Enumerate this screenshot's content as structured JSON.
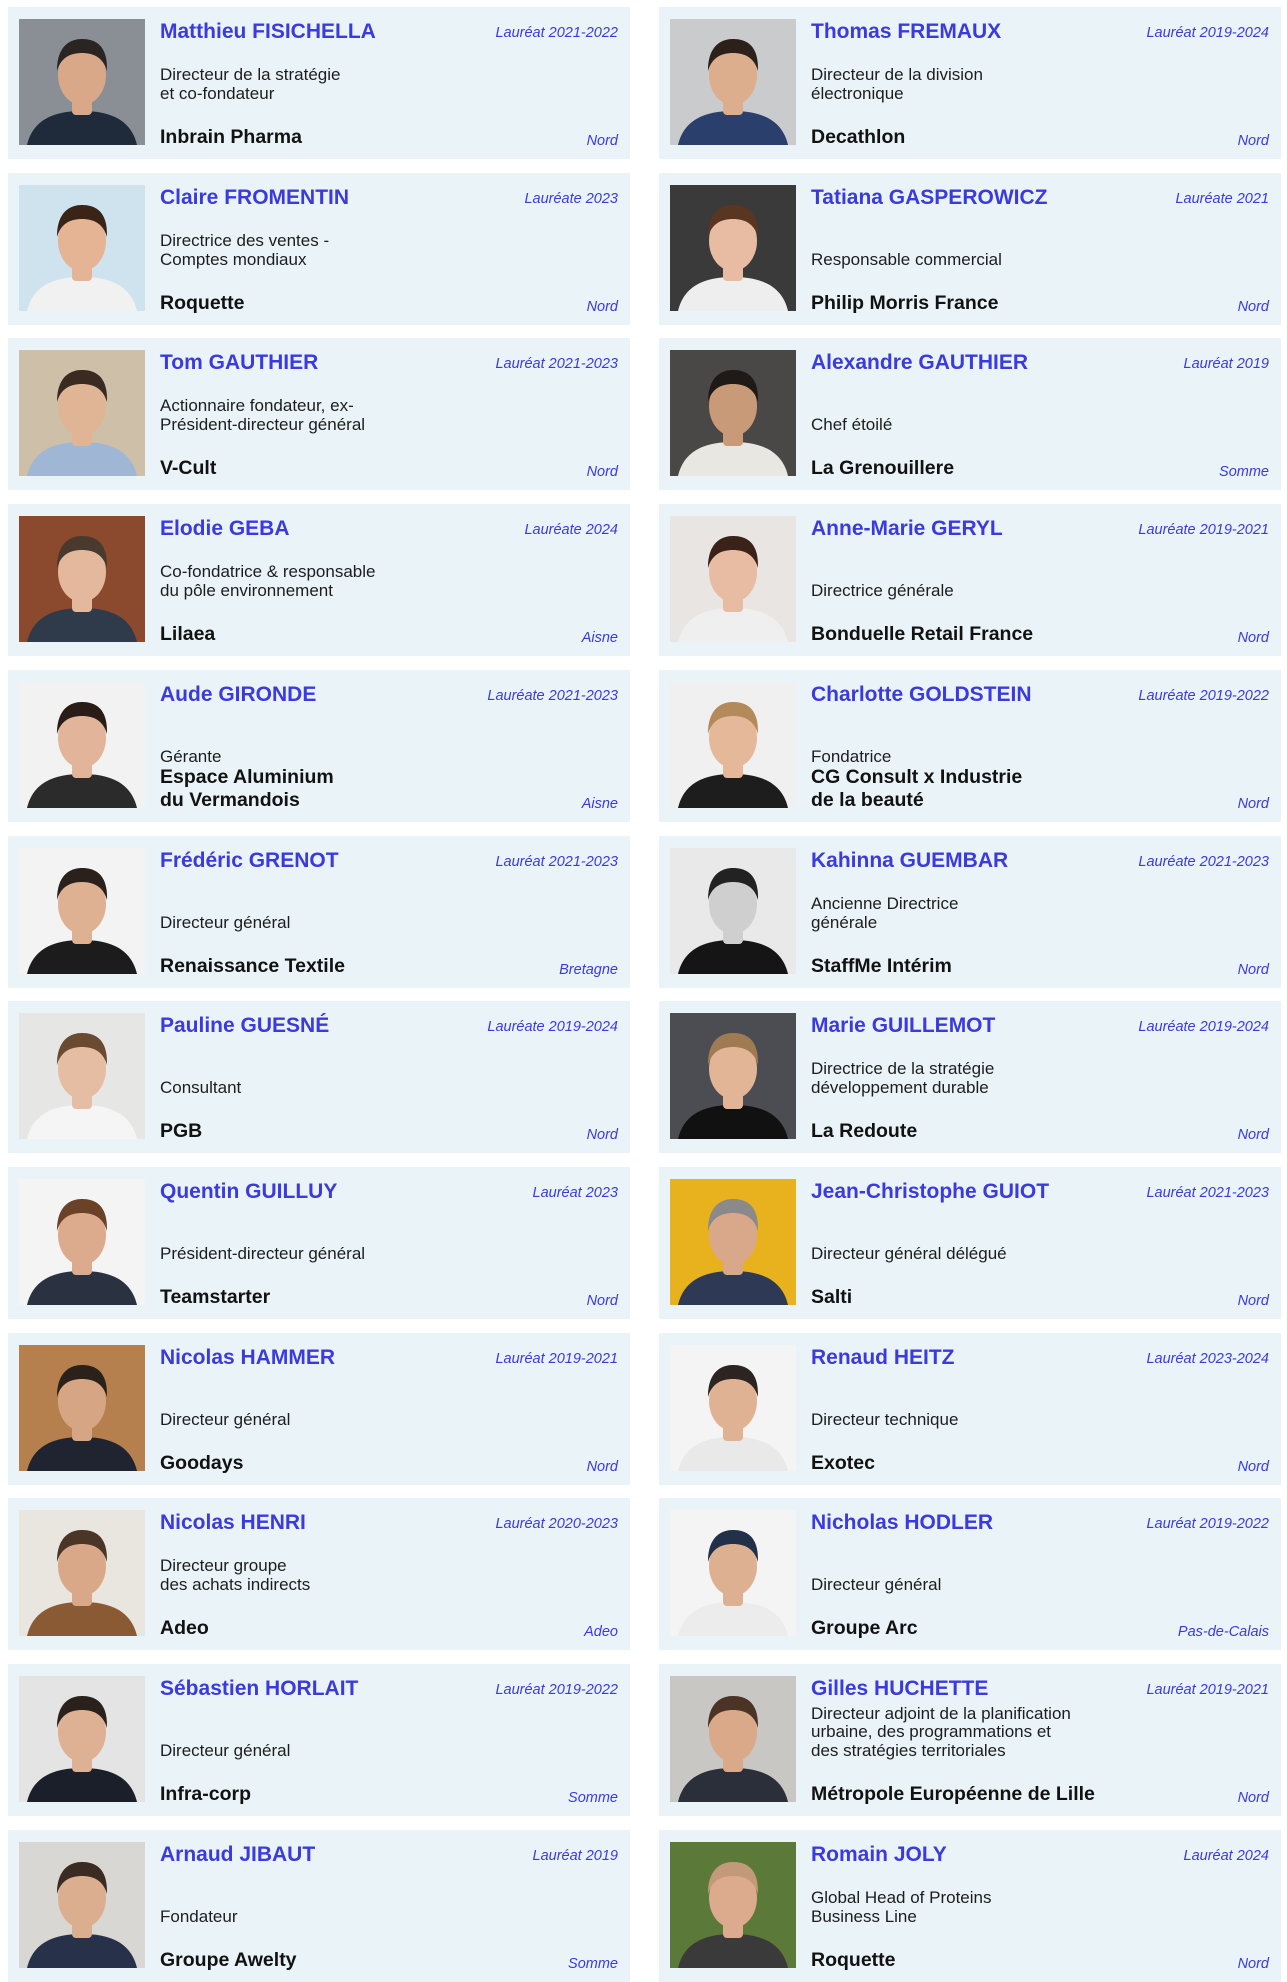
{
  "colors": {
    "accent": "#3a3adf",
    "card_bg": "#eaf4f8",
    "text": "#1d1d1d"
  },
  "cards": [
    {
      "name": "Matthieu FISICHELLA",
      "laureat": "Lauréat 2021-2022",
      "role": "Directeur de la stratégie\net co-fondateur",
      "company": "Inbrain Pharma",
      "region": "Nord",
      "photo": {
        "bg": "#8a8f96",
        "skin": "#d8a888",
        "hair": "#2a2522",
        "shirt": "#1f2a3a"
      }
    },
    {
      "name": "Thomas FREMAUX",
      "laureat": "Lauréat 2019-2024",
      "role": "Directeur de la division\nélectronique",
      "company": "Decathlon",
      "region": "Nord",
      "photo": {
        "bg": "#c9cbcd",
        "skin": "#dcae8e",
        "hair": "#2b201a",
        "shirt": "#2a3f6b"
      }
    },
    {
      "name": "Claire FROMENTIN",
      "laureat": "Lauréate 2023",
      "role": "Directrice des ventes -\nComptes mondiaux",
      "company": "Roquette",
      "region": "Nord",
      "photo": {
        "bg": "#cfe3ee",
        "skin": "#e4b494",
        "hair": "#3a2418",
        "shirt": "#f1f1f1"
      }
    },
    {
      "name": "Tatiana GASPEROWICZ",
      "laureat": "Lauréate 2021",
      "role": "Responsable commercial",
      "company": "Philip Morris France",
      "region": "Nord",
      "photo": {
        "bg": "#3a3a3a",
        "skin": "#e7bca2",
        "hair": "#5a3522",
        "shirt": "#eeeeee"
      }
    },
    {
      "name": "Tom GAUTHIER",
      "laureat": "Lauréat 2021-2023",
      "role": "Actionnaire fondateur, ex-\nPrésident-directeur général",
      "company": "V-Cult",
      "region": "Nord",
      "photo": {
        "bg": "#cdbfa8",
        "skin": "#dfb596",
        "hair": "#3a2a22",
        "shirt": "#9fb7d4"
      }
    },
    {
      "name": "Alexandre GAUTHIER",
      "laureat": "Lauréat 2019",
      "role": "Chef étoilé",
      "company": "La Grenouillere",
      "region": "Somme",
      "photo": {
        "bg": "#4a4846",
        "skin": "#c99a78",
        "hair": "#1f1a17",
        "shirt": "#e9e7e2"
      }
    },
    {
      "name": "Elodie GEBA",
      "laureat": "Lauréate 2024",
      "role": "Co-fondatrice &  responsable\ndu pôle environnement",
      "company": "Lilaea",
      "region": "Aisne",
      "photo": {
        "bg": "#8b4a2e",
        "skin": "#e3b89c",
        "hair": "#4a3a2e",
        "shirt": "#2f3b4a"
      }
    },
    {
      "name": "Anne-Marie GERYL",
      "laureat": "Lauréate 2019-2021",
      "role": "Directrice générale",
      "company": "Bonduelle Retail France",
      "region": "Nord",
      "photo": {
        "bg": "#e8e5e2",
        "skin": "#e7bca2",
        "hair": "#3b2219",
        "shirt": "#efefef"
      }
    },
    {
      "name": "Aude GIRONDE",
      "laureat": "Lauréate 2021-2023",
      "role": "Gérante",
      "company": "Espace Aluminium\ndu Vermandois",
      "region": "Aisne",
      "photo": {
        "bg": "#f2f2f2",
        "skin": "#e2b59a",
        "hair": "#2a1d17",
        "shirt": "#2b2b2b"
      }
    },
    {
      "name": "Charlotte GOLDSTEIN",
      "laureat": "Lauréate 2019-2022",
      "role": "Fondatrice",
      "company": "CG Consult x Industrie\nde la beauté",
      "region": "Nord",
      "photo": {
        "bg": "#f0f0f0",
        "skin": "#e6b89a",
        "hair": "#b58a5a",
        "shirt": "#1d1d1d"
      }
    },
    {
      "name": "Frédéric GRENOT",
      "laureat": "Lauréat 2021-2023",
      "role": "Directeur général",
      "company": "Renaissance Textile",
      "region": "Bretagne",
      "photo": {
        "bg": "#f3f3f3",
        "skin": "#dfb193",
        "hair": "#2a211c",
        "shirt": "#1c1c1c"
      }
    },
    {
      "name": "Kahinna GUEMBAR",
      "laureat": "Lauréate 2021-2023",
      "role": "Ancienne Directrice\ngénérale",
      "company": "StaffMe Intérim",
      "region": "Nord",
      "photo": {
        "bg": "#e9e9e9",
        "skin": "#cfcfcf",
        "hair": "#222222",
        "shirt": "#151515"
      }
    },
    {
      "name": "Pauline GUESNÉ",
      "laureat": "Lauréate 2019-2024",
      "role": "Consultant",
      "company": "PGB",
      "region": "Nord",
      "photo": {
        "bg": "#e6e6e4",
        "skin": "#e5bda2",
        "hair": "#6b4a32",
        "shirt": "#f5f5f5"
      }
    },
    {
      "name": "Marie GUILLEMOT",
      "laureat": "Lauréate 2019-2024",
      "role": "Directrice de la stratégie\ndéveloppement durable",
      "company": "La Redoute",
      "region": "Nord",
      "photo": {
        "bg": "#4b4d52",
        "skin": "#e2b597",
        "hair": "#a07a52",
        "shirt": "#111111"
      }
    },
    {
      "name": "Quentin GUILLUY",
      "laureat": "Lauréat 2023",
      "role": "Président-directeur général",
      "company": "Teamstarter",
      "region": "Nord",
      "photo": {
        "bg": "#f4f4f4",
        "skin": "#dcaa8c",
        "hair": "#6a4228",
        "shirt": "#2a3140"
      }
    },
    {
      "name": "Jean-Christophe GUIOT",
      "laureat": "Lauréat 2021-2023",
      "role": "Directeur général délégué",
      "company": "Salti",
      "region": "Nord",
      "photo": {
        "bg": "#e8b21f",
        "skin": "#d9a88a",
        "hair": "#8a8a8a",
        "shirt": "#2e3a55"
      }
    },
    {
      "name": "Nicolas HAMMER",
      "laureat": "Lauréat 2019-2021",
      "role": "Directeur général",
      "company": "Goodays",
      "region": "Nord",
      "photo": {
        "bg": "#b5804e",
        "skin": "#d6a584",
        "hair": "#2b211b",
        "shirt": "#1f2430"
      }
    },
    {
      "name": "Renaud HEITZ",
      "laureat": "Lauréat 2023-2024",
      "role": "Directeur technique",
      "company": "Exotec",
      "region": "Nord",
      "photo": {
        "bg": "#f4f4f4",
        "skin": "#e0b294",
        "hair": "#2b2420",
        "shirt": "#e9e9e9"
      }
    },
    {
      "name": "Nicolas HENRI",
      "laureat": "Lauréat 2020-2023",
      "role": "Directeur groupe\ndes achats indirects",
      "company": "Adeo",
      "region": "Adeo",
      "photo": {
        "bg": "#e9e6e0",
        "skin": "#d8a888",
        "hair": "#4a3526",
        "shirt": "#8a5a34"
      }
    },
    {
      "name": "Nicholas HODLER",
      "laureat": "Lauréat 2019-2022",
      "role": "Directeur général",
      "company": "Groupe Arc",
      "region": "Pas-de-Calais",
      "photo": {
        "bg": "#f4f4f4",
        "skin": "#ddb092",
        "hair": "#23304a",
        "shirt": "#ececec"
      }
    },
    {
      "name": "Sébastien HORLAIT",
      "laureat": "Lauréat 2019-2022",
      "role": "Directeur général",
      "company": "Infra-corp",
      "region": "Somme",
      "photo": {
        "bg": "#e4e4e4",
        "skin": "#deb094",
        "hair": "#2a211c",
        "shirt": "#1a1f2a"
      }
    },
    {
      "name": "Gilles HUCHETTE",
      "laureat": "Lauréat 2019-2021",
      "role": "Directeur adjoint de la planification\nurbaine, des programmations et\ndes stratégies territoriales",
      "company": "Métropole Européenne de Lille",
      "region": "Nord",
      "photo": {
        "bg": "#c9c7c3",
        "skin": "#d9a98a",
        "hair": "#4b3426",
        "shirt": "#2a2f3a"
      }
    },
    {
      "name": "Arnaud JIBAUT",
      "laureat": "Lauréat 2019",
      "role": "Fondateur",
      "company": "Groupe Awelty",
      "region": "Somme",
      "photo": {
        "bg": "#d9d7d3",
        "skin": "#dcae90",
        "hair": "#3a2c22",
        "shirt": "#27324a"
      }
    },
    {
      "name": "Romain JOLY",
      "laureat": "Lauréat 2024",
      "role": "Global Head of Proteins\nBusiness Line",
      "company": "Roquette",
      "region": "Nord",
      "photo": {
        "bg": "#5b7a3a",
        "skin": "#dcaa8c",
        "hair": "#c29a7a",
        "shirt": "#3a3a3a"
      }
    }
  ]
}
